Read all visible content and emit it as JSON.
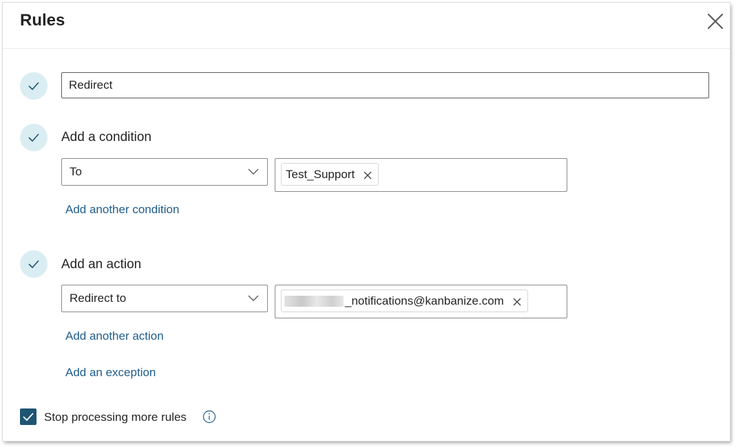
{
  "dialog": {
    "title": "Rules",
    "close_icon": "close-icon"
  },
  "rule_name": {
    "value": "Redirect"
  },
  "conditions": {
    "heading": "Add a condition",
    "field": "To",
    "recipient": "Test_Support",
    "add_link": "Add another condition"
  },
  "actions": {
    "heading": "Add an action",
    "field": "Redirect to",
    "recipient_visible": "_notifications@kanbanize.com",
    "add_link": "Add another action"
  },
  "exception": {
    "add_link": "Add an exception"
  },
  "stop_processing": {
    "label": "Stop processing more rules",
    "checked": true
  },
  "colors": {
    "accent": "#1d5573",
    "link": "#1f5c8b",
    "step_circle": "#daedf2"
  }
}
